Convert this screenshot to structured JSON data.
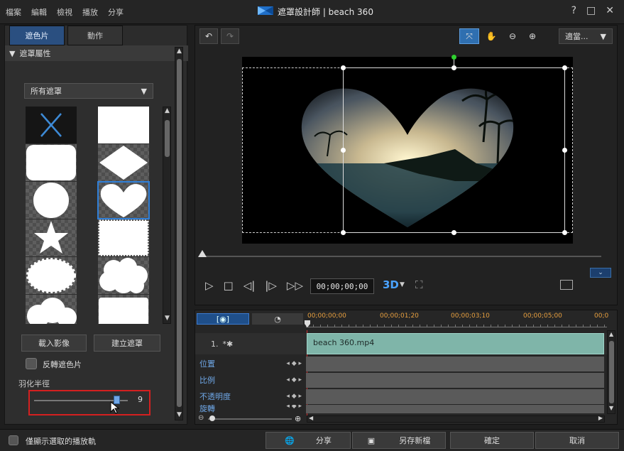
{
  "window": {
    "menu": [
      "檔案",
      "編輯",
      "檢視",
      "播放",
      "分享"
    ],
    "title": "遮罩設計師 | beach 360",
    "controls": {
      "help": "?",
      "maximize": "□",
      "close": "✕"
    }
  },
  "left": {
    "tabs": [
      {
        "label": "遮色片",
        "active": true
      },
      {
        "label": "動作",
        "active": false
      }
    ],
    "section_title": "遮罩屬性",
    "filter_dropdown": "所有遮罩",
    "shapes": [
      "none",
      "rectangle",
      "rounded-rectangle",
      "diamond",
      "circle",
      "heart",
      "star",
      "stamp",
      "burst",
      "cloud",
      "big-cloud",
      "wave-rectangle"
    ],
    "selected_shape": "heart",
    "import_button": "載入影像",
    "create_button": "建立遮罩",
    "invert_label": "反轉遮色片",
    "feather_label": "羽化半徑",
    "feather_value": "9",
    "feather_fraction": 0.88
  },
  "preview": {
    "fit_dropdown": "適當...",
    "timecode": "00;00;00;00",
    "three_d": "3D"
  },
  "timeline": {
    "ticks": [
      "00;00;00;00",
      "00;00;01;20",
      "00;00;03;10",
      "00;00;05;00",
      "00;0"
    ],
    "track_label": "1.",
    "clip_name": "beach 360.mp4",
    "keyframe_tracks": [
      "位置",
      "比例",
      "不透明度",
      "旋轉"
    ]
  },
  "bottom": {
    "show_selected_label": "僅顯示選取的播放軌",
    "share_button": "分享",
    "save_as_button": "另存新檔",
    "ok_button": "確定",
    "cancel_button": "取消"
  },
  "colors": {
    "clip_green": "#7fb5a9",
    "selection_blue": "#2f7fd8",
    "highlight_red": "#d42020",
    "playhead_red": "#d03030"
  }
}
